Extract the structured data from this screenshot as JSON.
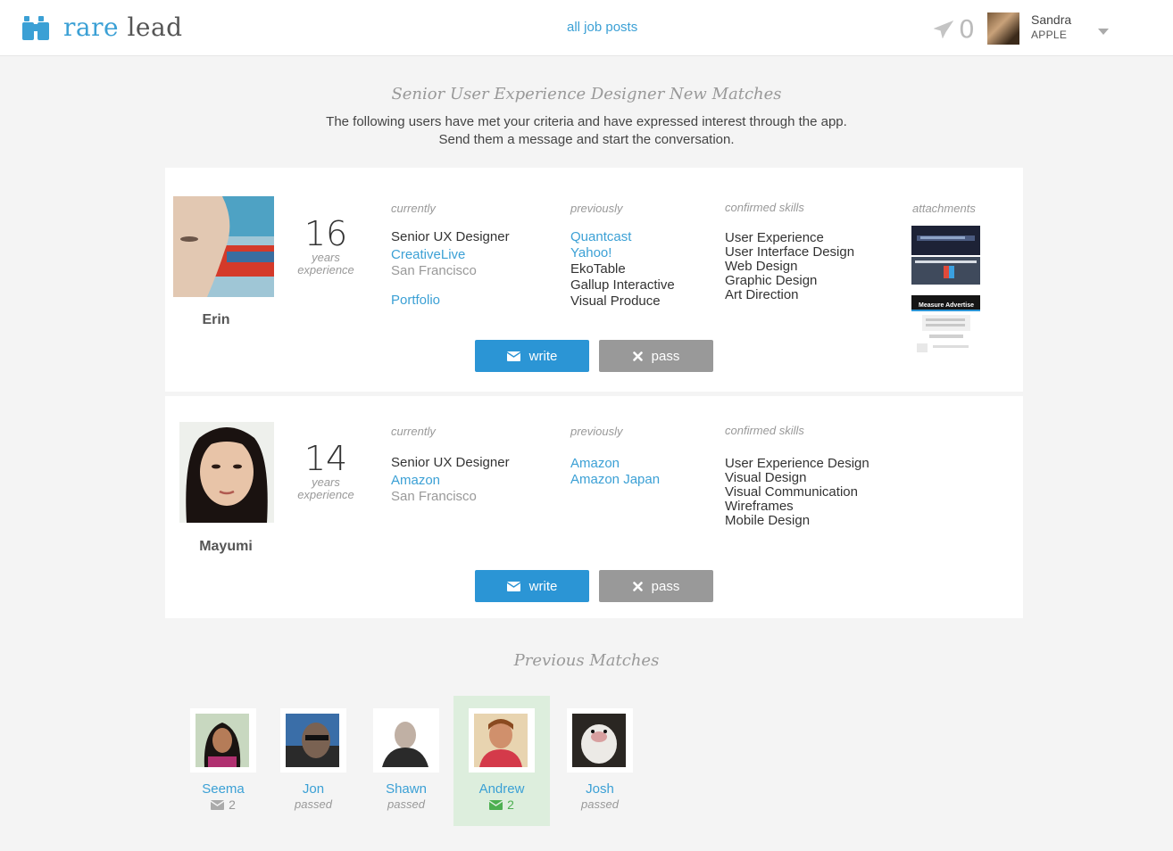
{
  "header": {
    "logo_rare": "rare",
    "logo_lead": "lead",
    "nav_link": "all job posts",
    "message_count": "0",
    "user_name": "Sandra",
    "user_company": "APPLE"
  },
  "main": {
    "title": "Senior User Experience Designer New Matches",
    "subtitle_line1": "The following users have met your criteria and have expressed interest through the app.",
    "subtitle_line2": "Send them a message and start the conversation."
  },
  "labels": {
    "currently": "currently",
    "previously": "previously",
    "skills": "confirmed skills",
    "attachments": "attachments",
    "years": "years",
    "experience": "experience",
    "write": "write",
    "pass": "pass"
  },
  "candidates": [
    {
      "name": "Erin",
      "years": "16",
      "current_title": "Senior UX Designer",
      "current_company": "CreativeLive",
      "location": "San Francisco",
      "portfolio": "Portfolio",
      "previously": [
        "Quantcast",
        "Yahoo!",
        "EkoTable",
        "Gallup Interactive",
        "Visual Produce"
      ],
      "skills": [
        "User Experience",
        "User Interface Design",
        "Web Design",
        "Graphic Design",
        "Art Direction"
      ],
      "attachment_text": "Measure Advertise"
    },
    {
      "name": "Mayumi",
      "years": "14",
      "current_title": "Senior UX Designer",
      "current_company": "Amazon",
      "location": "San Francisco",
      "previously": [
        "Amazon",
        "Amazon Japan"
      ],
      "skills": [
        "User Experience Design",
        "Visual Design",
        "Visual Communication",
        "Wireframes",
        "Mobile Design"
      ]
    }
  ],
  "previous": {
    "title": "Previous Matches",
    "items": [
      {
        "name": "Seema",
        "status": "",
        "count": "2"
      },
      {
        "name": "Jon",
        "status": "passed",
        "count": ""
      },
      {
        "name": "Shawn",
        "status": "passed",
        "count": ""
      },
      {
        "name": "Andrew",
        "status": "",
        "count": "2"
      },
      {
        "name": "Josh",
        "status": "passed",
        "count": ""
      }
    ]
  },
  "colors": {
    "accent": "#3ba0d5",
    "write_button": "#2b95d5",
    "pass_button": "#999999",
    "active_match": "#ddeedd",
    "background": "#f4f4f4"
  }
}
